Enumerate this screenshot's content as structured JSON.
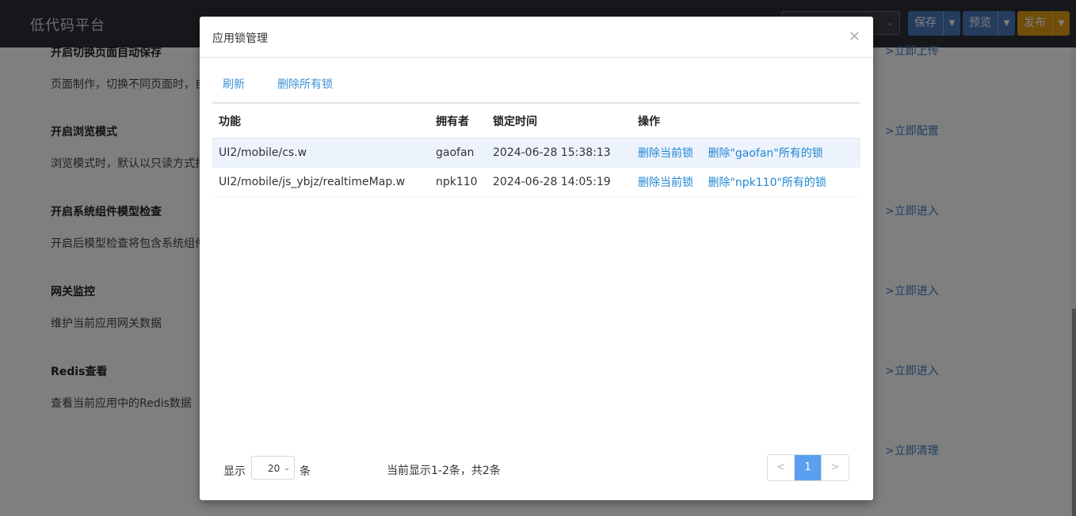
{
  "app": {
    "title": "低代码平台",
    "buttons": {
      "save": "保存",
      "preview": "预览",
      "publish": "发布"
    }
  },
  "background": {
    "settings": [
      {
        "title": "开启切换页面自动保存",
        "desc": "页面制作，切换不同页面时，自",
        "link": ">立即上传"
      },
      {
        "title": "开启浏览模式",
        "desc": "浏览模式时，默认以只读方式打",
        "link": ">立即配置"
      },
      {
        "title": "开启系统组件模型检查",
        "desc": "开启后模型检查将包含系统组件",
        "link": ">立即进入"
      },
      {
        "title": "网关监控",
        "desc": "维护当前应用网关数据",
        "link": ">立即进入"
      },
      {
        "title": "Redis查看",
        "desc": "查看当前应用中的Redis数据",
        "link": ">立即进入"
      },
      {
        "title": "",
        "desc": "",
        "link": ">立即清理"
      }
    ]
  },
  "dialog": {
    "title": "应用锁管理",
    "close": "×",
    "toolbar": {
      "refresh": "刷新",
      "delete_all": "删除所有锁"
    },
    "columns": [
      "功能",
      "拥有者",
      "锁定时间",
      "操作"
    ],
    "rows": [
      {
        "func": "UI2/mobile/cs.w",
        "owner": "gaofan",
        "time": "2024-06-28 15:38:13",
        "op1": "删除当前锁",
        "op2": "删除\"gaofan\"所有的锁"
      },
      {
        "func": "UI2/mobile/js_ybjz/realtimeMap.w",
        "owner": "npk110",
        "time": "2024-06-28 14:05:19",
        "op1": "删除当前锁",
        "op2": "删除\"npk110\"所有的锁"
      }
    ],
    "footer": {
      "show": "显示",
      "page_size": "20",
      "unit": "条",
      "summary": "当前显示1-2条，共2条",
      "prev": "<",
      "current_page": "1",
      "next": ">"
    }
  }
}
